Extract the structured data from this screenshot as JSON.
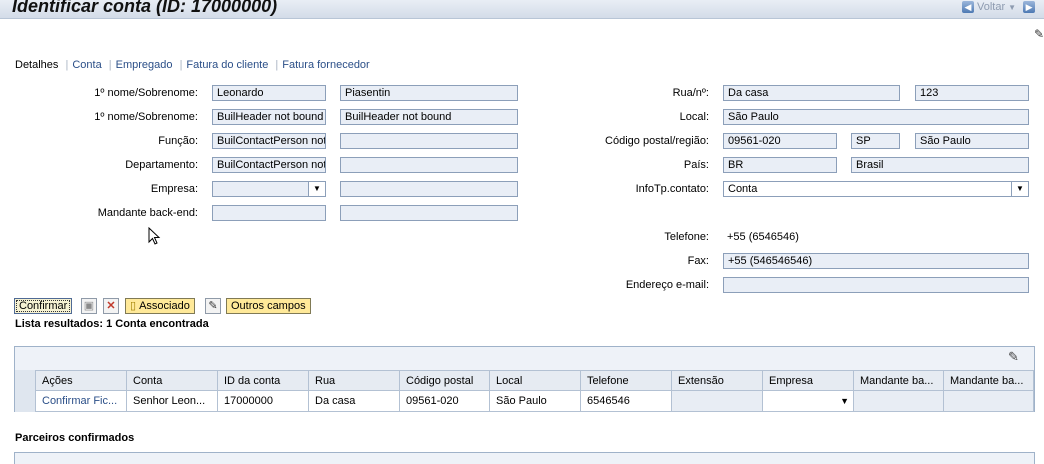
{
  "header": {
    "title": "Identificar conta (ID: 17000000)",
    "back_label": "Voltar"
  },
  "tabs": [
    "Detalhes",
    "Conta",
    "Empregado",
    "Fatura do cliente",
    "Fatura fornecedor"
  ],
  "left_form": {
    "name_label_1": "1º nome/Sobrenome:",
    "first_name": "Leonardo",
    "last_name": "Piasentin",
    "name_label_2": "1º nome/Sobrenome:",
    "first_name_2": "BuilHeader not bound",
    "last_name_2": "BuilHeader not bound",
    "function_label": "Função:",
    "function_value": "BuilContactPerson not",
    "department_label": "Departamento:",
    "department_value": "BuilContactPerson not",
    "company_label": "Empresa:",
    "backend_label": "Mandante back-end:"
  },
  "right_form": {
    "street_label": "Rua/nº:",
    "street": "Da casa",
    "number": "123",
    "local_label": "Local:",
    "local": "São Paulo",
    "postal_label": "Código postal/região:",
    "postal": "09561-020",
    "region_code": "SP",
    "region": "São Paulo",
    "country_label": "País:",
    "country_code": "BR",
    "country": "Brasil",
    "contact_type_label": "InfoTp.contato:",
    "contact_type": "Conta",
    "phone_label": "Telefone:",
    "phone": "+55 (6546546)",
    "fax_label": "Fax:",
    "fax": "+55 (546546546)",
    "email_label": "Endereço e-mail:",
    "email": ""
  },
  "toolbar": {
    "confirm": "Confirmar",
    "associate": "Associado",
    "more_fields": "Outros campos"
  },
  "results": {
    "count_text": "Lista resultados: 1 Conta encontrada",
    "columns": [
      "Ações",
      "Conta",
      "ID da conta",
      "Rua",
      "Código postal",
      "Local",
      "Telefone",
      "Extensão",
      "Empresa",
      "Mandante ba...",
      "Mandante ba..."
    ],
    "row": {
      "actions": "Confirmar  Fic...",
      "account": "Senhor Leon...",
      "account_id": "17000000",
      "street": "Da casa",
      "postal": "09561-020",
      "local": "São Paulo",
      "phone": "6546546",
      "extension": "",
      "company": ""
    }
  },
  "partners": {
    "title": "Parceiros confirmados"
  },
  "icons": {
    "back": "arrow-left-icon",
    "forward": "arrow-right-icon",
    "settings": "wrench-icon",
    "save": "floppy-icon",
    "delete": "x-icon",
    "associate": "new-document-icon",
    "edit": "edit-icon",
    "table_edit": "pencil-icon",
    "cursor": "mouse-pointer-icon"
  }
}
